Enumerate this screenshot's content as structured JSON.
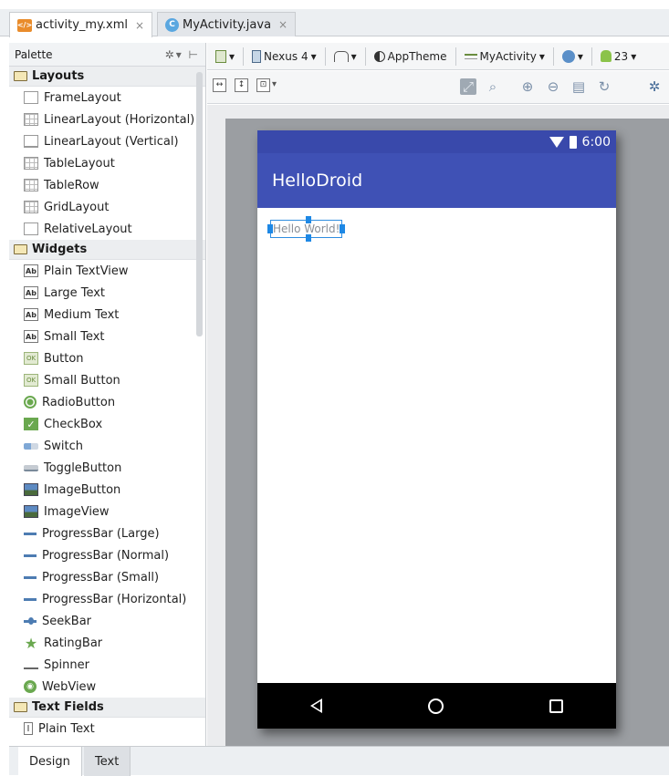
{
  "tabs": [
    {
      "label": "activity_my.xml",
      "close": "×"
    },
    {
      "label": "MyActivity.java",
      "close": "×"
    }
  ],
  "palette": {
    "title": "Palette",
    "groups": [
      {
        "label": "Layouts",
        "items": [
          "FrameLayout",
          "LinearLayout (Horizontal)",
          "LinearLayout (Vertical)",
          "TableLayout",
          "TableRow",
          "GridLayout",
          "RelativeLayout"
        ]
      },
      {
        "label": "Widgets",
        "items": [
          "Plain TextView",
          "Large Text",
          "Medium Text",
          "Small Text",
          "Button",
          "Small Button",
          "RadioButton",
          "CheckBox",
          "Switch",
          "ToggleButton",
          "ImageButton",
          "ImageView",
          "ProgressBar (Large)",
          "ProgressBar (Normal)",
          "ProgressBar (Small)",
          "ProgressBar (Horizontal)",
          "SeekBar",
          "RatingBar",
          "Spinner",
          "WebView"
        ]
      },
      {
        "label": "Text Fields",
        "items": [
          "Plain Text"
        ]
      }
    ]
  },
  "toolbar": {
    "device": "Nexus 4",
    "theme": "AppTheme",
    "activity": "MyActivity",
    "api": "23"
  },
  "device": {
    "time": "6:00",
    "app_title": "HelloDroid",
    "hello_text": "Hello World!"
  },
  "bottom_tabs": [
    "Design",
    "Text"
  ],
  "colors": {
    "status_bar": "#3949ab",
    "app_bar": "#3f51b5",
    "selection": "#1e88e5"
  }
}
